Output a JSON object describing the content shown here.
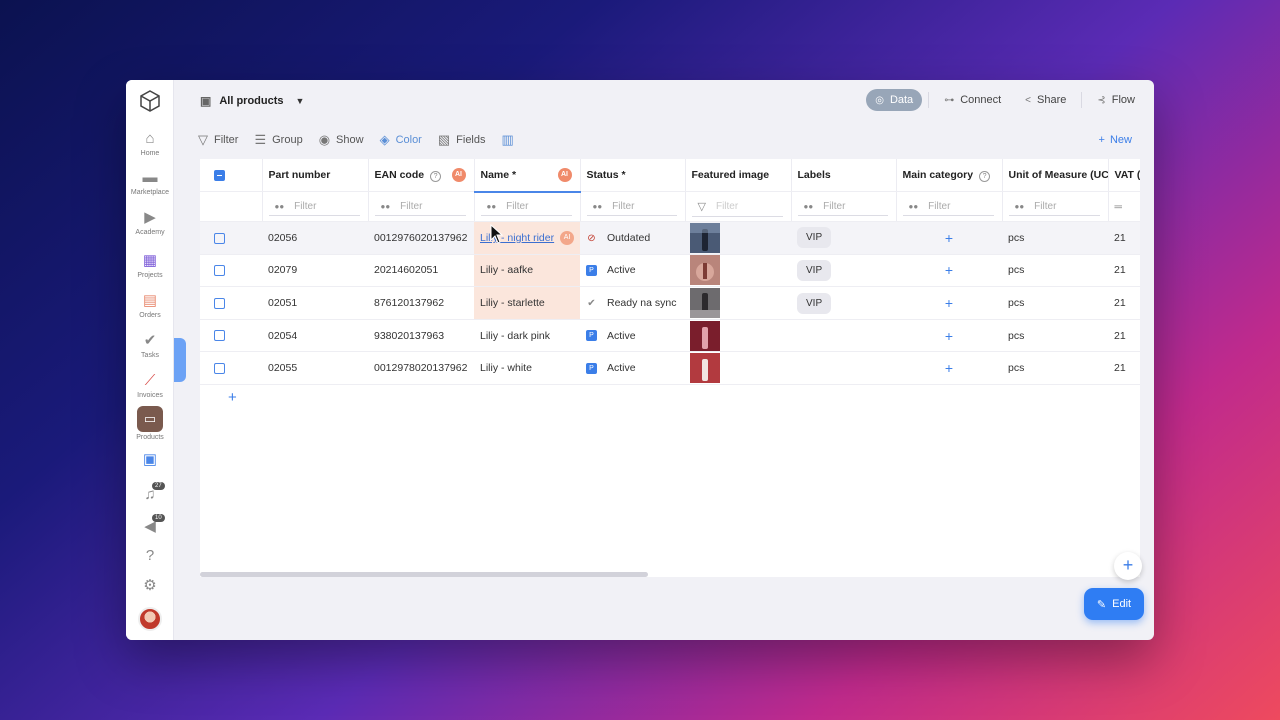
{
  "sidebar": {
    "items": [
      {
        "label": "Home",
        "icon": "home-icon"
      },
      {
        "label": "Marketplace",
        "icon": "store-icon"
      },
      {
        "label": "Academy",
        "icon": "play-icon"
      },
      {
        "label": "Projects",
        "icon": "projects-icon"
      },
      {
        "label": "Orders",
        "icon": "orders-icon"
      },
      {
        "label": "Tasks",
        "icon": "check-icon"
      },
      {
        "label": "Invoices",
        "icon": "invoice-icon"
      },
      {
        "label": "Products",
        "icon": "products-icon"
      }
    ],
    "notifications_count": "27",
    "announcements_count": "10"
  },
  "header": {
    "title": "All products",
    "actions": {
      "data": "Data",
      "connect": "Connect",
      "share": "Share",
      "flow": "Flow"
    }
  },
  "toolbar": {
    "filter": "Filter",
    "group": "Group",
    "show": "Show",
    "color": "Color",
    "fields": "Fields",
    "new": "New"
  },
  "table": {
    "columns": [
      "Part number",
      "EAN code",
      "Name *",
      "Status *",
      "Featured image",
      "Labels",
      "Main category",
      "Unit of Measure (UC",
      "VAT (%"
    ],
    "filter_placeholder": "Filter",
    "rows": [
      {
        "part": "02056",
        "ean": "0012976020137962",
        "name": "Lilly - night rider",
        "status": "Outdated",
        "label": "VIP",
        "unit": "pcs",
        "vat": "21"
      },
      {
        "part": "02079",
        "ean": "20214602051",
        "name": "Liliy - aafke",
        "status": "Active",
        "label": "VIP",
        "unit": "pcs",
        "vat": "21"
      },
      {
        "part": "02051",
        "ean": "876120137962",
        "name": "Liliy - starlette",
        "status": "Ready na sync",
        "label": "VIP",
        "unit": "pcs",
        "vat": "21"
      },
      {
        "part": "02054",
        "ean": "938020137963",
        "name": "Liliy - dark pink",
        "status": "Active",
        "label": "",
        "unit": "pcs",
        "vat": "21"
      },
      {
        "part": "02055",
        "ean": "0012978020137962",
        "name": "Liliy - white",
        "status": "Active",
        "label": "",
        "unit": "pcs",
        "vat": "21"
      }
    ]
  },
  "edit_button": "Edit",
  "colors": {
    "accent": "#3b7ee8",
    "name_highlight": "#fbe6dc",
    "status_outdated": "#c0392b"
  }
}
